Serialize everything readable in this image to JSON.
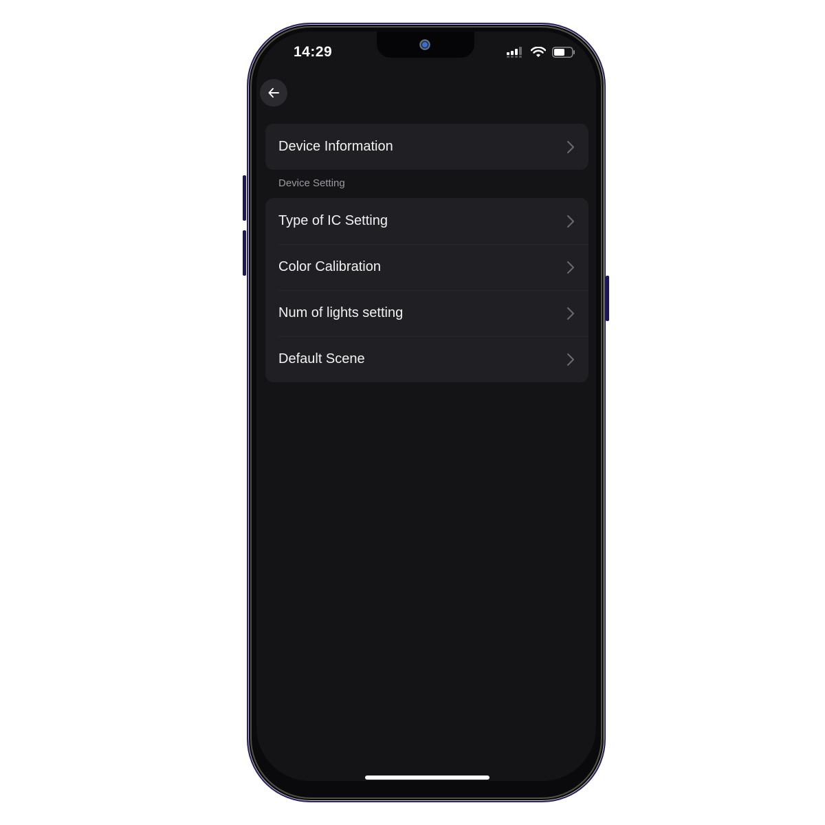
{
  "status_bar": {
    "time": "14:29",
    "signal_icon": "cellular-signal-icon",
    "wifi_icon": "wifi-icon",
    "battery_icon": "battery-icon",
    "battery_level": 0.6
  },
  "nav": {
    "back_icon": "arrow-left-icon"
  },
  "sections": [
    {
      "title": "",
      "items": [
        {
          "label": "Device Information",
          "icon": "chevron-right-icon"
        }
      ]
    },
    {
      "title": "Device Setting",
      "items": [
        {
          "label": "Type of IC Setting",
          "icon": "chevron-right-icon"
        },
        {
          "label": "Color Calibration",
          "icon": "chevron-right-icon"
        },
        {
          "label": "Num of lights setting",
          "icon": "chevron-right-icon"
        },
        {
          "label": "Default Scene",
          "icon": "chevron-right-icon"
        }
      ]
    }
  ],
  "colors": {
    "background": "#141417",
    "card": "#202024",
    "text": "#f2f2f2",
    "section_title": "#9a9aa0",
    "chevron": "#6a6a70"
  }
}
